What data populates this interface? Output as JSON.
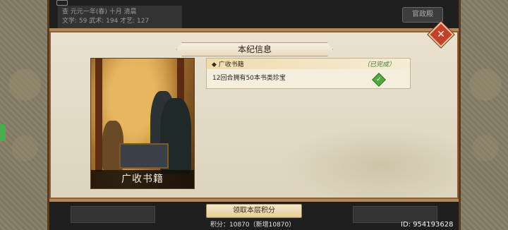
{
  "background": {
    "info_lines": [
      "查 元元一年(春) 十月 清晨",
      "文学: 59    武术: 194    才艺: 127"
    ],
    "top_right_button": "官政殿"
  },
  "dialog": {
    "title": "本纪信息",
    "close_icon": "close-icon"
  },
  "illustration": {
    "caption": "广收书籍"
  },
  "task": {
    "marker": "◆",
    "name": "广收书籍",
    "status": "（已完成）",
    "description": "12回合拥有50本书类珍宝",
    "status_icon": "check-icon"
  },
  "footer": {
    "claim_button": "领取本层积分",
    "points": "积分：10870（新增10870）",
    "player_id": "ID: 954193628"
  },
  "colors": {
    "accent": "#c2402c",
    "complete": "#53a83e",
    "panel": "#e9e2d0"
  }
}
